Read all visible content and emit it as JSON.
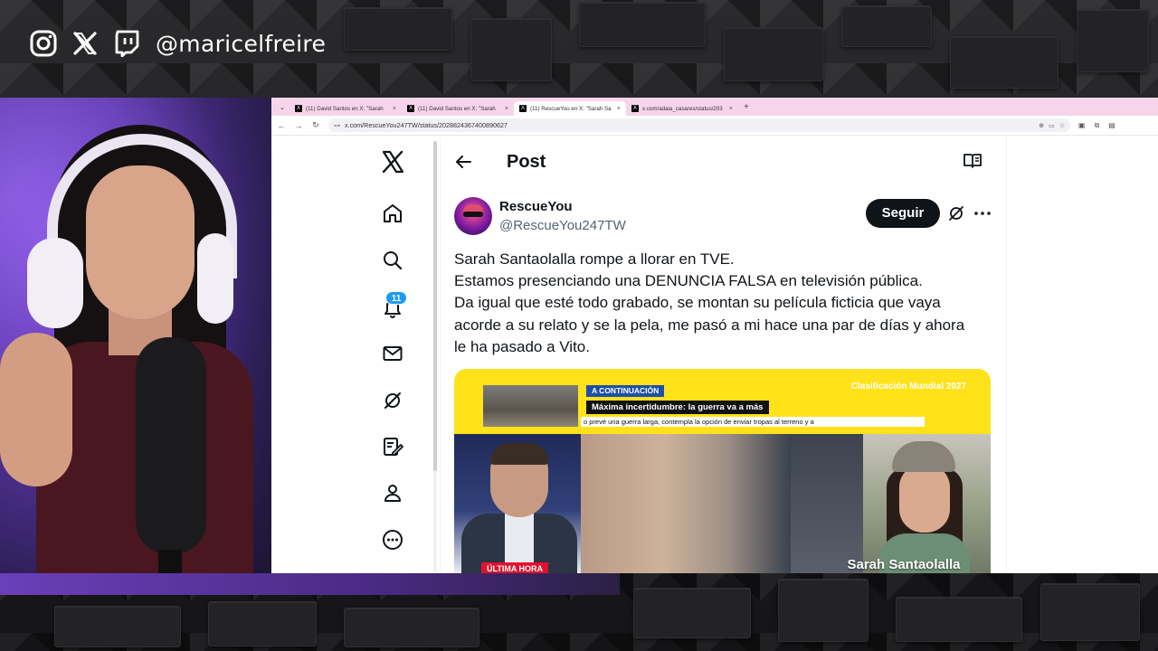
{
  "overlay": {
    "handle": "@maricelfreire",
    "icons": [
      "instagram-icon",
      "x-icon",
      "twitch-icon"
    ]
  },
  "browser": {
    "tabs": [
      {
        "title": "(11) David Santos en X: \"Sarah",
        "active": false
      },
      {
        "title": "(11) David Santos en X: \"Sarah",
        "active": false
      },
      {
        "title": "(11) RescueYou en X: \"Sarah Sa",
        "active": true
      },
      {
        "title": "x.com/adaia_casares/status/203",
        "active": false
      }
    ],
    "url": "x.com/RescueYou247TW/status/2028824367400890627"
  },
  "x": {
    "notifications_count": "11",
    "header_title": "Post",
    "author": {
      "name": "RescueYou",
      "handle": "@RescueYou247TW"
    },
    "follow_label": "Seguir",
    "tweet_lines": [
      "Sarah Santaolalla rompe a llorar en TVE.",
      "Estamos presenciando una DENUNCIA FALSA en televisión pública.",
      "Da igual que esté todo grabado, se montan su película ficticia que vaya",
      "acorde a su relato y se la pela, me pasó a mi hace una par de días y ahora",
      "le ha pasado a Vito."
    ],
    "media": {
      "a_continuacion": "A CONTINUACIÓN",
      "headline": "Máxima incertidumbre: la guerra va a más",
      "ticker": "o prevé una guerra larga, contempla la opción de enviar tropas al terreno y a",
      "clasificacion": "Clasificación Mundial 2027",
      "ultima_hora": "ÚLTIMA HORA",
      "caption": "Sarah Santaolalla"
    }
  },
  "colors": {
    "x_blue": "#1d9bf0",
    "tab_bar": "#f6d5ea",
    "follow_button": "#0f1419",
    "breaking_red": "#e0122e",
    "tv_yellow": "#ffe21a"
  }
}
